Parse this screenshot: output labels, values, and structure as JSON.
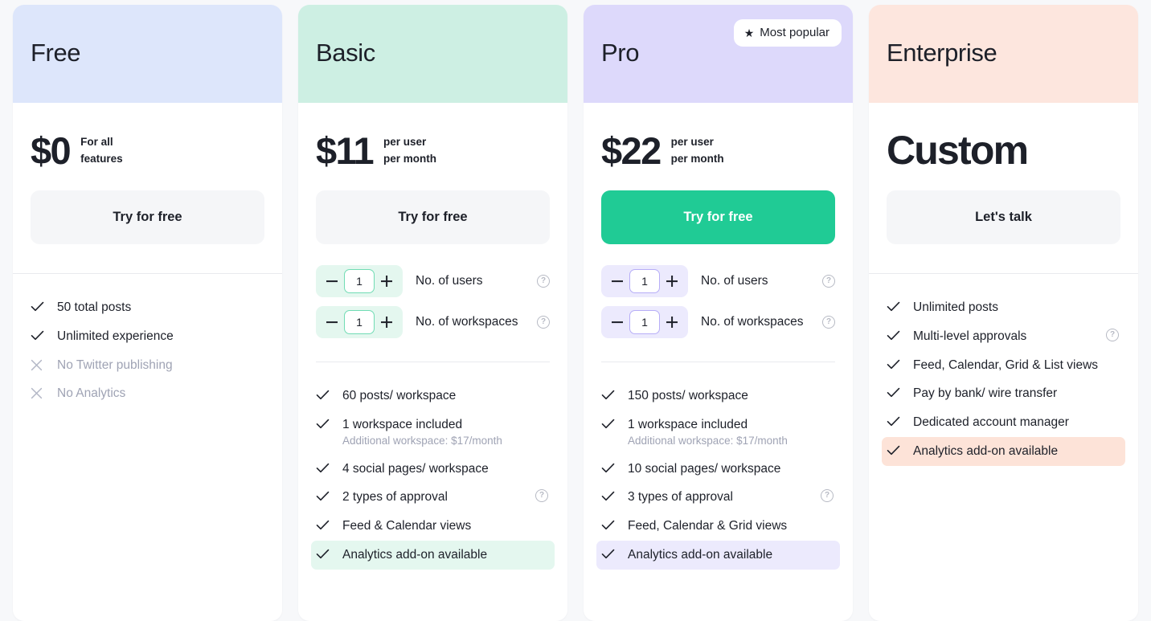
{
  "colors": {
    "page_bg": "#f7f8fa",
    "free_header": "#dde6fb",
    "basic_header": "#cdefe3",
    "pro_header": "#ddd9fb",
    "enterprise_header": "#fde6de",
    "primary_button": "#20cb95",
    "neutral_button": "#f5f6f8",
    "highlight_green": "#e4f7ef",
    "highlight_purple": "#eceafd",
    "highlight_peach": "#fde3d8",
    "muted_text": "#9fa3b4"
  },
  "badge": {
    "label": "Most popular",
    "icon": "star-icon",
    "glyph": "★"
  },
  "icons": {
    "help": "?",
    "check": "check-icon",
    "cross": "cross-icon"
  },
  "stepper": {
    "decrement_label": "−",
    "increment_label": "+",
    "users_label": "No. of users",
    "workspaces_label": "No. of workspaces",
    "users_value": "1",
    "workspaces_value": "1"
  },
  "plans": [
    {
      "name": "Free",
      "price": "$0",
      "price_meta": [
        "For all",
        "features"
      ],
      "cta": "Try for free",
      "cta_style": "neutral",
      "has_steppers": false,
      "divider": "full",
      "features": [
        {
          "mark": "check",
          "label": "50 total posts",
          "sub": null,
          "muted": false,
          "help": false,
          "highlight": null
        },
        {
          "mark": "check",
          "label": "Unlimited experience",
          "sub": null,
          "muted": false,
          "help": false,
          "highlight": null
        },
        {
          "mark": "cross",
          "label": "No Twitter publishing",
          "sub": null,
          "muted": true,
          "help": false,
          "highlight": null
        },
        {
          "mark": "cross",
          "label": "No Analytics",
          "sub": null,
          "muted": true,
          "help": false,
          "highlight": null
        }
      ]
    },
    {
      "name": "Basic",
      "price": "$11",
      "price_meta": [
        "per user",
        "per month"
      ],
      "cta": "Try for free",
      "cta_style": "neutral",
      "has_steppers": true,
      "stepper_theme": "green",
      "divider": "inset",
      "features": [
        {
          "mark": "check",
          "label": "60 posts/ workspace",
          "sub": null,
          "muted": false,
          "help": false,
          "highlight": null
        },
        {
          "mark": "check",
          "label": "1 workspace included",
          "sub": "Additional workspace: $17/month",
          "muted": false,
          "help": false,
          "highlight": null
        },
        {
          "mark": "check",
          "label": "4 social pages/ workspace",
          "sub": null,
          "muted": false,
          "help": false,
          "highlight": null
        },
        {
          "mark": "check",
          "label": "2 types of approval",
          "sub": null,
          "muted": false,
          "help": true,
          "highlight": null
        },
        {
          "mark": "check",
          "label": "Feed & Calendar views",
          "sub": null,
          "muted": false,
          "help": false,
          "highlight": null
        },
        {
          "mark": "check",
          "label": "Analytics add-on available",
          "sub": null,
          "muted": false,
          "help": false,
          "highlight": "green"
        }
      ]
    },
    {
      "name": "Pro",
      "price": "$22",
      "price_meta": [
        "per user",
        "per month"
      ],
      "cta": "Try for free",
      "cta_style": "primary",
      "has_steppers": true,
      "stepper_theme": "purple",
      "divider": "inset",
      "badge": true,
      "features": [
        {
          "mark": "check",
          "label": "150 posts/ workspace",
          "sub": null,
          "muted": false,
          "help": false,
          "highlight": null
        },
        {
          "mark": "check",
          "label": "1 workspace included",
          "sub": "Additional workspace: $17/month",
          "muted": false,
          "help": false,
          "highlight": null
        },
        {
          "mark": "check",
          "label": "10 social pages/ workspace",
          "sub": null,
          "muted": false,
          "help": false,
          "highlight": null
        },
        {
          "mark": "check",
          "label": "3 types of approval",
          "sub": null,
          "muted": false,
          "help": true,
          "highlight": null
        },
        {
          "mark": "check",
          "label": "Feed, Calendar & Grid views",
          "sub": null,
          "muted": false,
          "help": false,
          "highlight": null
        },
        {
          "mark": "check",
          "label": "Analytics add-on available",
          "sub": null,
          "muted": false,
          "help": false,
          "highlight": "purple"
        }
      ]
    },
    {
      "name": "Enterprise",
      "price": "Custom",
      "price_meta": [],
      "cta": "Let's talk",
      "cta_style": "neutral",
      "has_steppers": false,
      "divider": "full",
      "features": [
        {
          "mark": "check",
          "label": "Unlimited posts",
          "sub": null,
          "muted": false,
          "help": false,
          "highlight": null
        },
        {
          "mark": "check",
          "label": "Multi-level approvals",
          "sub": null,
          "muted": false,
          "help": true,
          "highlight": null
        },
        {
          "mark": "check",
          "label": "Feed, Calendar, Grid & List views",
          "sub": null,
          "muted": false,
          "help": false,
          "highlight": null
        },
        {
          "mark": "check",
          "label": "Pay by bank/ wire transfer",
          "sub": null,
          "muted": false,
          "help": false,
          "highlight": null
        },
        {
          "mark": "check",
          "label": "Dedicated account manager",
          "sub": null,
          "muted": false,
          "help": false,
          "highlight": null
        },
        {
          "mark": "check",
          "label": "Analytics add-on available",
          "sub": null,
          "muted": false,
          "help": false,
          "highlight": "peach"
        }
      ]
    }
  ]
}
